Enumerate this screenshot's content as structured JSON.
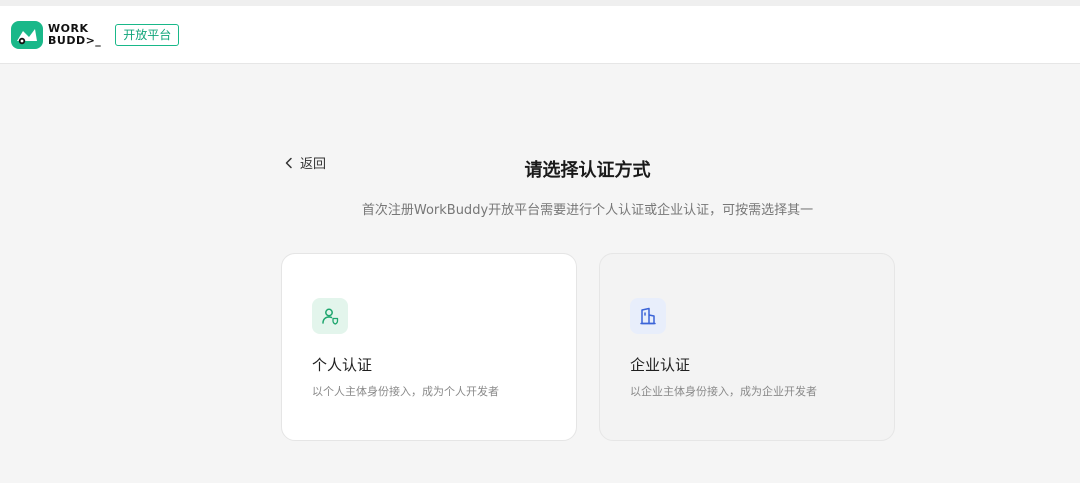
{
  "header": {
    "logo_line1": "WORK",
    "logo_line2": "BUDD>_",
    "platform_badge": "开放平台"
  },
  "nav": {
    "back_label": "返回"
  },
  "main": {
    "title": "请选择认证方式",
    "subtitle": "首次注册WorkBuddy开放平台需要进行个人认证或企业认证，可按需选择其一"
  },
  "cards": [
    {
      "title": "个人认证",
      "desc": "以个人主体身份接入，成为个人开发者",
      "icon": "user-shield-icon",
      "icon_color": "#1ea66e"
    },
    {
      "title": "企业认证",
      "desc": "以企业主体身份接入，成为企业开发者",
      "icon": "building-icon",
      "icon_color": "#3b64d8"
    }
  ],
  "colors": {
    "brand_green": "#19b889",
    "page_bg": "#f5f5f5"
  }
}
